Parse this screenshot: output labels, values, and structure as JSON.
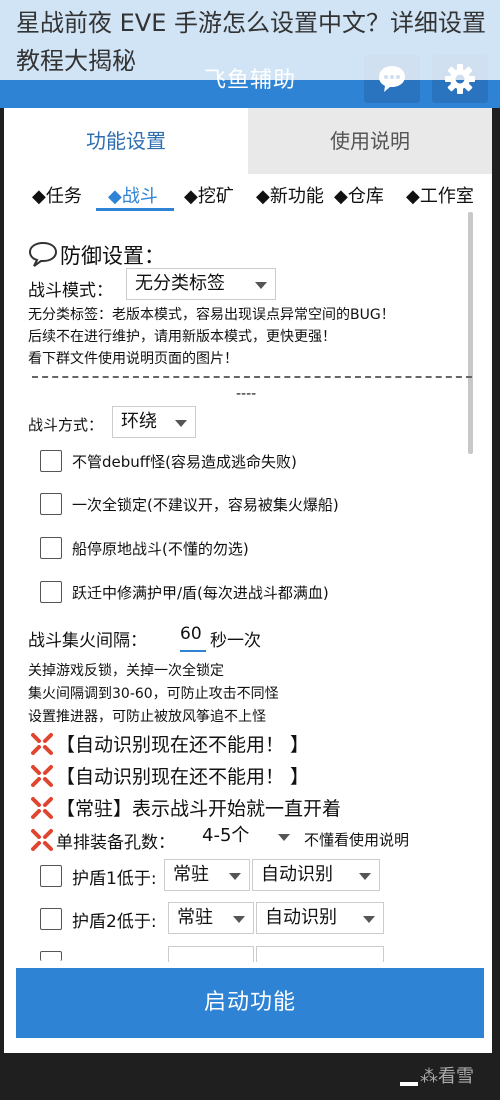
{
  "article_title": "星战前夜 EVE 手游怎么设置中文？详细设置教程大揭秘",
  "app": {
    "title": "飞鱼辅助",
    "icons": [
      "chat-icon",
      "gear-icon"
    ],
    "accent": "#2f83d4"
  },
  "tabs": [
    {
      "label": "功能设置"
    },
    {
      "label": "使用说明"
    }
  ],
  "categories": [
    {
      "label": "◆任务"
    },
    {
      "label": "◆战斗"
    },
    {
      "label": "◆挖矿"
    },
    {
      "label": "◆新功能"
    },
    {
      "label": "◆仓库"
    },
    {
      "label": "◆工作室"
    }
  ],
  "defense": {
    "heading": "防御设置：",
    "mode_label": "战斗模式：",
    "mode_value": "无分类标签",
    "note1": "无分类标签：老版本模式，容易出现误点异常空间的BUG！",
    "note2": "后续不在进行维护，请用新版本模式，更快更强！",
    "note3": "看下群文件使用说明页面的图片！",
    "dashes": "----"
  },
  "combat": {
    "method_label": "战斗方式：",
    "method_value": "环绕",
    "options": [
      {
        "label": "不管debuff怪(容易造成逃命失败)"
      },
      {
        "label": "一次全锁定(不建议开，容易被集火爆船)"
      },
      {
        "label": "船停原地战斗(不懂的勿选)"
      },
      {
        "label": "跃迁中修满护甲/盾(每次进战斗都满血)"
      }
    ],
    "interval_label": "战斗集火间隔：",
    "interval_value": "60",
    "interval_suffix": "秒一次",
    "tip1": "关掉游戏反锁，关掉一次全锁定",
    "tip2": "集火间隔调到30-60，可防止攻击不同怪",
    "tip3": "设置推进器，可防止被放风筝追不上怪"
  },
  "notices": [
    {
      "text": "【自动识别现在还不能用！ 】"
    },
    {
      "text": "【自动识别现在还不能用！ 】"
    },
    {
      "text": "【常驻】表示战斗开始就一直开着"
    }
  ],
  "equipment": {
    "label": "单排装备孔数：",
    "value": "4-5个",
    "help": "不懂看使用说明",
    "rows": [
      {
        "label": "护盾1低于:",
        "mode": "常驻",
        "detect": "自动识别"
      },
      {
        "label": "护盾2低于:",
        "mode": "常驻",
        "detect": "自动识别"
      }
    ]
  },
  "start_button": "启动功能",
  "watermark": "⁂看雪"
}
